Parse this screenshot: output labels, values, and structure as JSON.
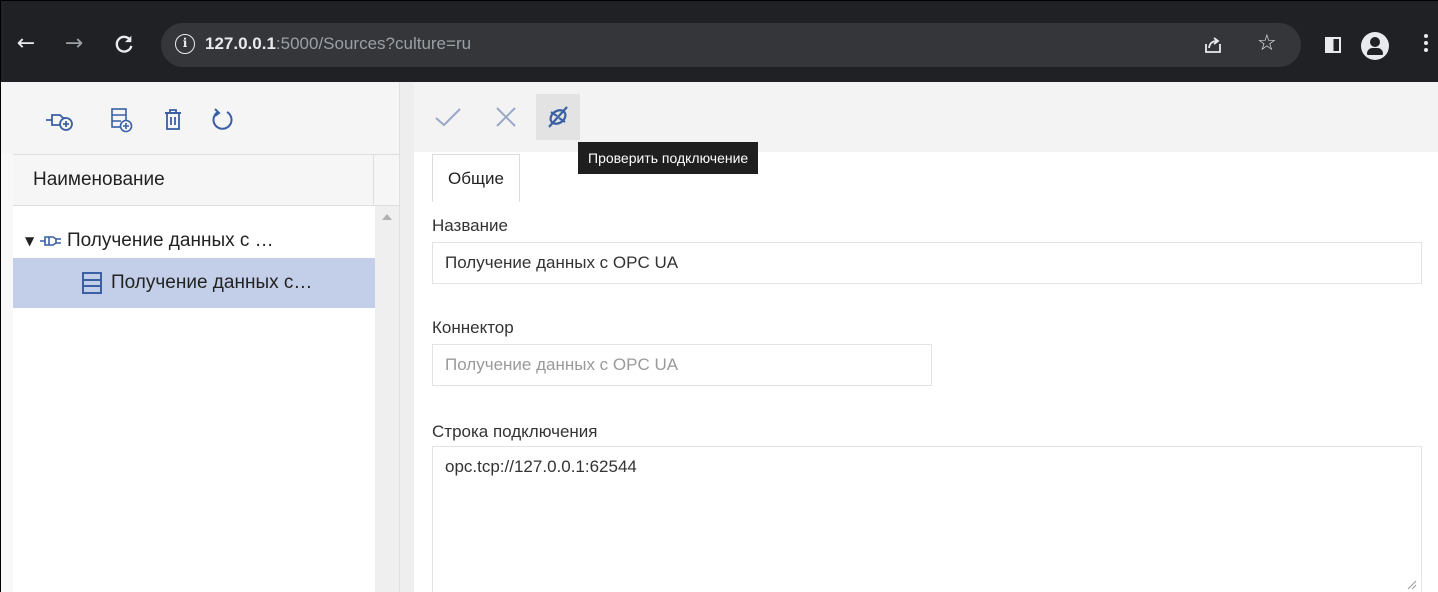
{
  "browser": {
    "url_host": "127.0.0.1",
    "url_rest": ":5000/Sources?culture=ru",
    "nav_icons": [
      "back-arrow-icon",
      "forward-arrow-icon",
      "reload-icon"
    ],
    "right_icons": [
      "share-icon",
      "star-icon",
      "side-panel-icon",
      "profile-icon",
      "kebab-menu-icon"
    ]
  },
  "left_panel": {
    "toolbar_icons": [
      "add-connection-icon",
      "add-item-icon",
      "delete-icon",
      "refresh-icon"
    ],
    "grid": {
      "column_header": "Наименование",
      "rows": [
        {
          "label": "Получение данных с …",
          "icon": "connector-plug-icon",
          "expanded": true,
          "level": 0
        },
        {
          "label": "Получение данных с…",
          "icon": "list-table-icon",
          "selected": true,
          "level": 1
        }
      ]
    }
  },
  "right_panel": {
    "toolbar_icons": [
      "check-icon",
      "close-icon",
      "test-connection-icon"
    ],
    "tooltip": "Проверить подключение",
    "tabs": [
      {
        "label": "Общие",
        "active": true
      }
    ],
    "fields": {
      "name": {
        "label": "Название",
        "value": "Получение данных с OPC UA"
      },
      "connector": {
        "label": "Коннектор",
        "value": "Получение данных с OPC UA",
        "disabled": true
      },
      "connection_string": {
        "label": "Строка подключения",
        "value": "opc.tcp://127.0.0.1:62544"
      }
    }
  },
  "colors": {
    "icon_blue": "#3a5fa5",
    "toolbar_check_icon": "#9aa8c8",
    "selected_row": "#c3cfe8",
    "chrome_dark": "#202124"
  }
}
